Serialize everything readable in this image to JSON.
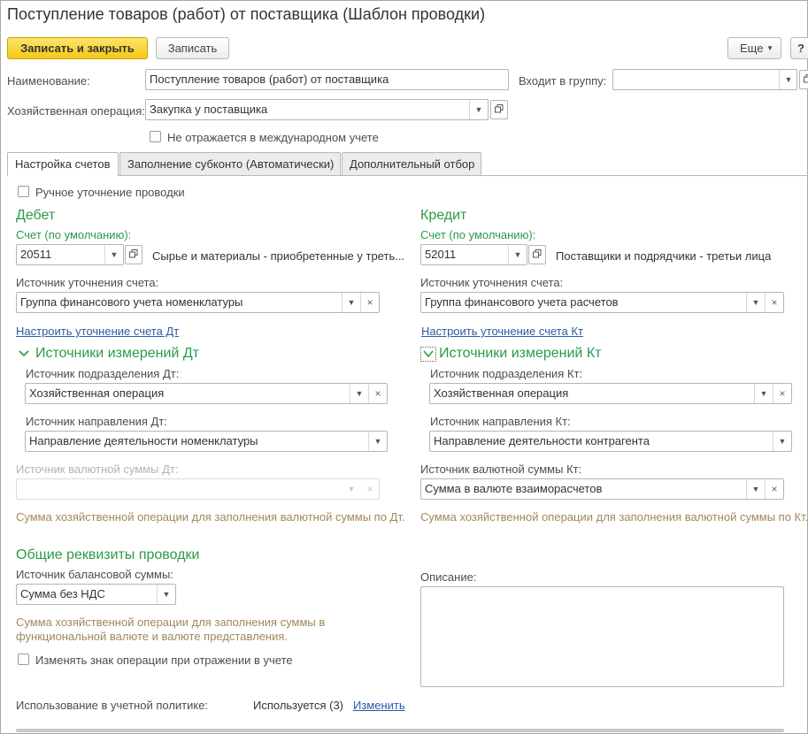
{
  "window": {
    "title": "Поступление товаров (работ) от поставщика (Шаблон проводки)"
  },
  "toolbar": {
    "save_close": "Записать и закрыть",
    "save": "Записать",
    "more": "Еще",
    "help": "?"
  },
  "header": {
    "name_label": "Наименование:",
    "name_value": "Поступление товаров (работ) от поставщика",
    "group_label": "Входит в группу:",
    "group_value": "",
    "operation_label": "Хозяйственная операция:",
    "operation_value": "Закупка у поставщика",
    "intl_label": "Не отражается в международном учете"
  },
  "tabs": [
    {
      "label": "Настройка счетов",
      "active": true
    },
    {
      "label": "Заполнение субконто (Автоматически)",
      "active": false
    },
    {
      "label": "Дополнительный отбор",
      "active": false
    }
  ],
  "manual": {
    "label": "Ручное уточнение проводки"
  },
  "debit": {
    "title": "Дебет",
    "account_label": "Счет (по умолчанию):",
    "account_value": "20511",
    "account_desc": "Сырье и материалы - приобретенные у треть...",
    "source_label": "Источник уточнения счета:",
    "source_value": "Группа финансового учета номенклатуры",
    "configure_link": "Настроить уточнение счета Дт",
    "dims_title": "Источники измерений Дт",
    "dept_label": "Источник подразделения Дт:",
    "dept_value": "Хозяйственная операция",
    "direction_label": "Источник направления Дт:",
    "direction_value": "Направление деятельности номенклатуры",
    "currency_label": "Источник валютной суммы Дт:",
    "currency_value": "",
    "currency_hint": "Сумма хозяйственной операции для заполнения валютной суммы по Дт."
  },
  "credit": {
    "title": "Кредит",
    "account_label": "Счет (по умолчанию):",
    "account_value": "52011",
    "account_desc": "Поставщики и подрядчики - третьи лица",
    "source_label": "Источник уточнения счета:",
    "source_value": "Группа финансового учета расчетов",
    "configure_link": "Настроить уточнение счета Кт",
    "dims_title": "Источники измерений Кт",
    "dept_label": "Источник подразделения Кт:",
    "dept_value": "Хозяйственная операция",
    "direction_label": "Источник направления Кт:",
    "direction_value": "Направление деятельности контрагента",
    "currency_label": "Источник валютной суммы Кт:",
    "currency_value": "Сумма в валюте взаиморасчетов",
    "currency_hint": "Сумма хозяйственной операции для заполнения валютной суммы по Кт."
  },
  "common": {
    "title": "Общие реквизиты проводки",
    "balance_label": "Источник балансовой суммы:",
    "balance_value": "Сумма без НДС",
    "balance_hint_1": "Сумма хозяйственной операции для заполнения суммы в",
    "balance_hint_2": "функциональной валюте и валюте представления.",
    "sign_label": "Изменять знак операции при отражении в учете",
    "description_label": "Описание:",
    "policy_label": "Использование в учетной политике:",
    "policy_value": "Используется (3)",
    "policy_link": "Изменить"
  },
  "colors": {
    "accent_green": "#2b9a48",
    "primary_button": "#f5c816",
    "link": "#2a5aa6",
    "hint": "#a0895a"
  }
}
